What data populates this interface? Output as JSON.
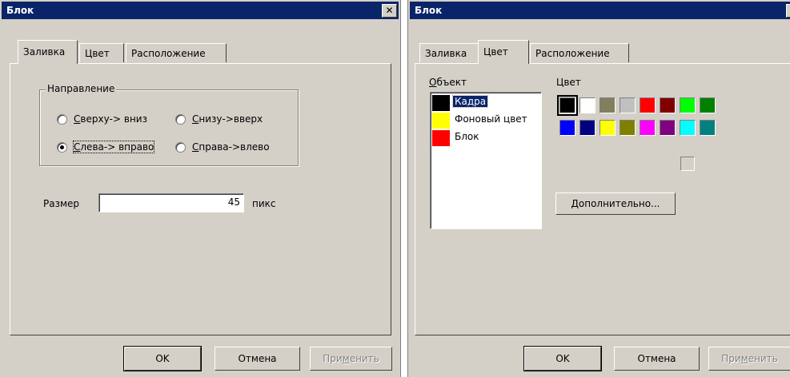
{
  "left_dialog": {
    "title": "Блок",
    "close": "✕",
    "tabs": [
      {
        "label": "Заливка",
        "active": true
      },
      {
        "label": "Цвет",
        "active": false
      },
      {
        "label": "Расположение",
        "active": false
      }
    ],
    "direction": {
      "label": "Направление",
      "options": [
        {
          "prefix": "",
          "hot": "С",
          "rest": "верху-> вниз",
          "selected": false
        },
        {
          "prefix": "",
          "hot": "С",
          "rest": "низу->вверх",
          "selected": false
        },
        {
          "prefix": "",
          "hot": "С",
          "rest": "лева-> вправо",
          "selected": true
        },
        {
          "prefix": "",
          "hot": "С",
          "rest": "права->влево",
          "selected": false
        }
      ]
    },
    "size": {
      "label": "Размер",
      "value": "45",
      "unit": "пикс"
    },
    "buttons": {
      "ok": "OK",
      "cancel": "Отмена",
      "apply_pre": "При",
      "apply_hot": "м",
      "apply_post": "енить"
    }
  },
  "right_dialog": {
    "title": "Блок",
    "close": "✕",
    "tabs": [
      {
        "label": "Заливка",
        "active": false
      },
      {
        "label": "Цвет",
        "active": true
      },
      {
        "label": "Расположение",
        "active": false
      }
    ],
    "object_label_hot": "О",
    "object_label_rest": "бъект",
    "objects": [
      {
        "label": "Кадра",
        "color": "#000000",
        "selected": true
      },
      {
        "label": "Фоновый цвет",
        "color": "#ffff00",
        "selected": false
      },
      {
        "label": "Блок",
        "color": "#ff0000",
        "selected": false
      }
    ],
    "color_label": "Цвет",
    "palette": [
      "#000000",
      "#ffffff",
      "#808060",
      "#c0c0c0",
      "#ff0000",
      "#800000",
      "#00ff00",
      "#008000",
      "#0000ff",
      "#000080",
      "#ffff00",
      "#808000",
      "#ff00ff",
      "#800080",
      "#00ffff",
      "#008080"
    ],
    "selected_color_index": 0,
    "more_button": "Дополнительно...",
    "buttons": {
      "ok": "OK",
      "cancel": "Отмена",
      "apply_pre": "При",
      "apply_hot": "м",
      "apply_post": "енить"
    }
  }
}
